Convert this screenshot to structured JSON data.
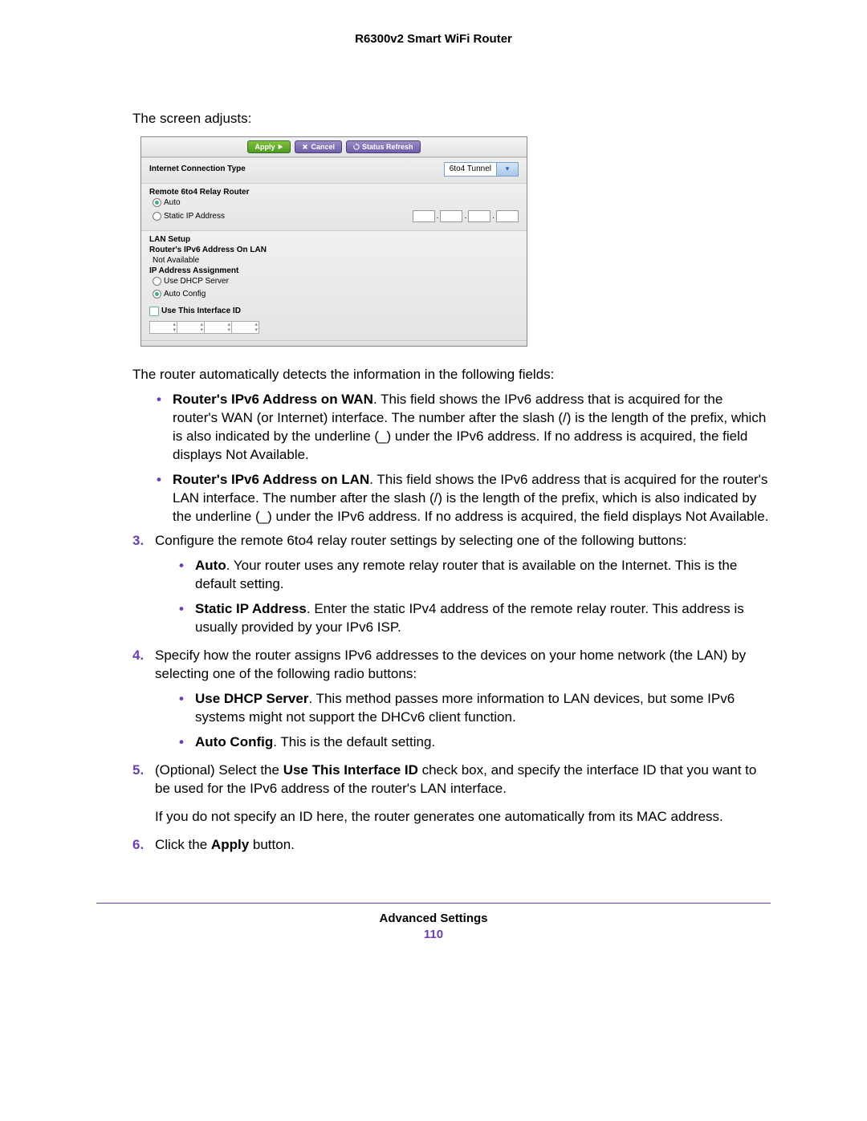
{
  "header": {
    "title": "R6300v2 Smart WiFi Router"
  },
  "intro": "The screen adjusts:",
  "router_panel": {
    "buttons": {
      "apply": "Apply",
      "cancel": "Cancel",
      "refresh": "Status Refresh"
    },
    "conn_type_label": "Internet Connection Type",
    "conn_type_value": "6to4 Tunnel",
    "relay_heading": "Remote 6to4 Relay Router",
    "relay_auto": "Auto",
    "relay_static": "Static IP Address",
    "lan_setup": "LAN Setup",
    "ipv6_lan_label": "Router's IPv6 Address On LAN",
    "ipv6_lan_value": "Not Available",
    "ip_assign_label": "IP Address Assignment",
    "ip_assign_dhcp": "Use DHCP Server",
    "ip_assign_auto": "Auto Config",
    "use_iface": "Use This Interface ID"
  },
  "after_detects": "The router automatically detects the information in the following fields:",
  "detect_bullets": [
    {
      "b": "Router's IPv6 Address on WAN",
      "t": ". This field shows the IPv6 address that is acquired for the router's WAN (or Internet) interface. The number after the slash (/) is the length of the prefix, which is also indicated by the underline (_) under the IPv6 address. If no address is acquired, the field displays Not Available."
    },
    {
      "b": "Router's IPv6 Address on LAN",
      "t": ". This field shows the IPv6 address that is acquired for the router's LAN interface. The number after the slash (/) is the length of the prefix, which is also indicated by the underline (_) under the IPv6 address. If no address is acquired, the field displays Not Available."
    }
  ],
  "steps": [
    {
      "text": "Configure the remote 6to4 relay router settings by selecting one of the following buttons:",
      "bullets": [
        {
          "b": "Auto",
          "t": ". Your router uses any remote relay router that is available on the Internet. This is the default setting."
        },
        {
          "b": "Static IP Address",
          "t": ". Enter the static IPv4 address of the remote relay router. This address is usually provided by your IPv6 ISP."
        }
      ]
    },
    {
      "text": "Specify how the router assigns IPv6 addresses to the devices on your home network (the LAN) by selecting one of the following radio buttons:",
      "bullets": [
        {
          "b": "Use DHCP Server",
          "t": ". This method passes more information to LAN devices, but some IPv6 systems might not support the DHCv6 client function."
        },
        {
          "b": "Auto Config",
          "t": ". This is the default setting."
        }
      ]
    },
    {
      "pre": "(Optional) Select the ",
      "bold": "Use This Interface ID",
      "post": " check box, and specify the interface ID that you want to be used for the IPv6 address of the router's LAN interface.",
      "extra": "If you do not specify an ID here, the router generates one automatically from its MAC address."
    },
    {
      "pre": "Click the ",
      "bold": "Apply",
      "post": " button."
    }
  ],
  "footer": {
    "section": "Advanced Settings",
    "page": "110"
  }
}
